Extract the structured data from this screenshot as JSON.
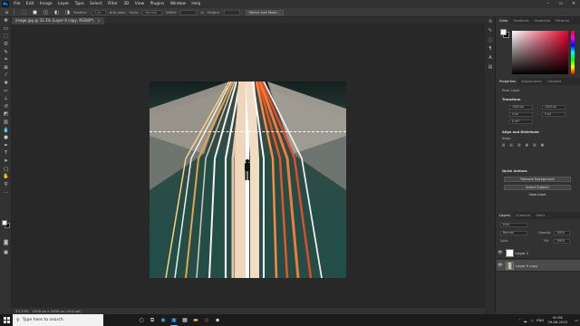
{
  "app": {
    "title": "Adobe Photoshop",
    "logo": "Ps"
  },
  "menu": [
    "File",
    "Edit",
    "Image",
    "Layer",
    "Type",
    "Select",
    "Filter",
    "3D",
    "View",
    "Plugins",
    "Window",
    "Help"
  ],
  "options_bar": {
    "feather_label": "Feather:",
    "feather_value": "0 px",
    "antialias_label": "Anti-alias",
    "style_label": "Style:",
    "style_value": "Normal",
    "width_label": "Width:",
    "height_label": "Height:",
    "select_mask_button": "Select and Mask..."
  },
  "document_tab": {
    "label": "image.jpg @ 33.3% (Layer 0 copy, RGB/8*)",
    "close": "×"
  },
  "status_bar": {
    "zoom": "33.33%",
    "doc_info": "1000 px x 1000 px (144 ppi)"
  },
  "panels": {
    "color": {
      "tabs": [
        "Color",
        "Swatches",
        "Gradients",
        "Patterns"
      ],
      "fg_color": "#ffffff",
      "bg_color": "#000000",
      "hue_color": "#e8002c"
    },
    "properties": {
      "tabs": [
        "Properties",
        "Adjustments",
        "Libraries"
      ],
      "kind": "Pixel Layer",
      "transform_header": "Transform",
      "w": "1000 px",
      "h": "1000 px",
      "x": "0 px",
      "y": "0 px",
      "angle": "0.00°",
      "align_header": "Align and Distribute",
      "align_label": "Align:",
      "quick_header": "Quick Actions",
      "remove_bg": "Remove Background",
      "select_subject": "Select Subject",
      "view_more": "View more"
    },
    "layers": {
      "tabs": [
        "Layers",
        "Channels",
        "Paths"
      ],
      "filter_kind": "Kind",
      "blend_mode": "Normal",
      "opacity_label": "Opacity:",
      "opacity_value": "100%",
      "lock_label": "Lock:",
      "fill_label": "Fill:",
      "fill_value": "100%",
      "items": [
        {
          "name": "Layer 1",
          "selected": false
        },
        {
          "name": "Layer 0 copy",
          "selected": true
        }
      ]
    }
  },
  "taskbar": {
    "search_placeholder": "Type here to search",
    "time": "00:08",
    "date": "29-06-2022",
    "lang": "ENG"
  },
  "photo": {
    "figure_present": true
  }
}
